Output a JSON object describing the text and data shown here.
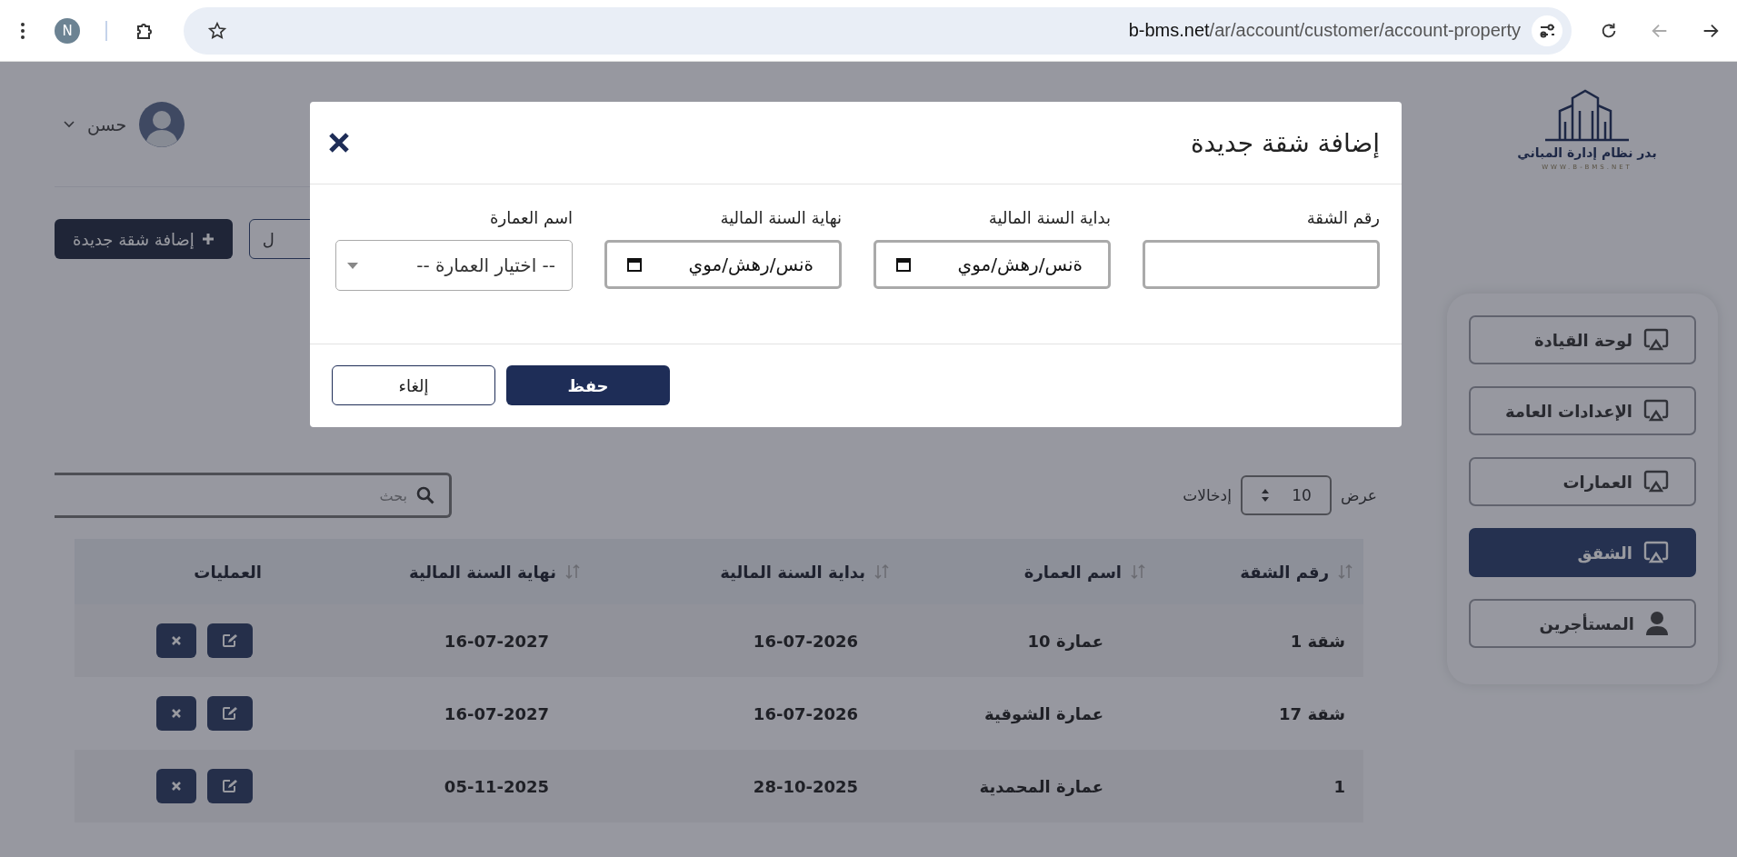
{
  "browser": {
    "profile_initial": "N",
    "url_host": "b-bms.net",
    "url_path": "/ar/account/customer/account-property"
  },
  "sidebar": {
    "logo_title": "بدر نظام إدارة المباني",
    "logo_url": "WWW.B-BMS.NET",
    "items": [
      {
        "label": "لوحة القيادة",
        "kind": "screen",
        "selected": false
      },
      {
        "label": "الإعدادات العامة",
        "kind": "screen",
        "selected": false
      },
      {
        "label": "العمارات",
        "kind": "screen",
        "selected": false
      },
      {
        "label": "الشقق",
        "kind": "screen",
        "selected": true
      },
      {
        "label": "المستأجرين",
        "kind": "user",
        "selected": false
      }
    ]
  },
  "user": {
    "name": "حسن"
  },
  "toolbar": {
    "buttons": [
      {
        "label": "ل",
        "kind": "outline"
      },
      {
        "label": "إضافة شقة جديدة",
        "kind": "primary"
      }
    ]
  },
  "table_controls": {
    "show_label": "عرض",
    "page_size": "10",
    "entries_label": "إدخالات",
    "search_placeholder": "بحث"
  },
  "table": {
    "columns": [
      {
        "label": "رقم الشقة",
        "sortable": true
      },
      {
        "label": "اسم العمارة",
        "sortable": true
      },
      {
        "label": "بداية السنة المالية",
        "sortable": true
      },
      {
        "label": "نهاية السنة المالية",
        "sortable": true
      },
      {
        "label": "العمليات",
        "sortable": false
      }
    ],
    "rows": [
      [
        "شقة 1",
        "عمارة 10",
        "16-07-2026",
        "16-07-2027"
      ],
      [
        "شقة 17",
        "عمارة الشوقية",
        "16-07-2026",
        "16-07-2027"
      ],
      [
        "1",
        "عمارة المحمدية",
        "28-10-2025",
        "05-11-2025"
      ]
    ]
  },
  "modal": {
    "title": "إضافة شقة جديدة",
    "fields": [
      {
        "label": "رقم الشقة",
        "kind": "text"
      },
      {
        "label": "بداية السنة المالية",
        "kind": "date",
        "placeholder": "ةنس/رهش/موي"
      },
      {
        "label": "نهاية السنة المالية",
        "kind": "date",
        "placeholder": "ةنس/رهش/موي"
      },
      {
        "label": "اسم العمارة",
        "kind": "select",
        "value": "-- اختيار العمارة --"
      }
    ],
    "buttons": [
      {
        "label": "حفظ",
        "kind": "primary"
      },
      {
        "label": "إلغاء",
        "kind": "outline"
      }
    ]
  }
}
